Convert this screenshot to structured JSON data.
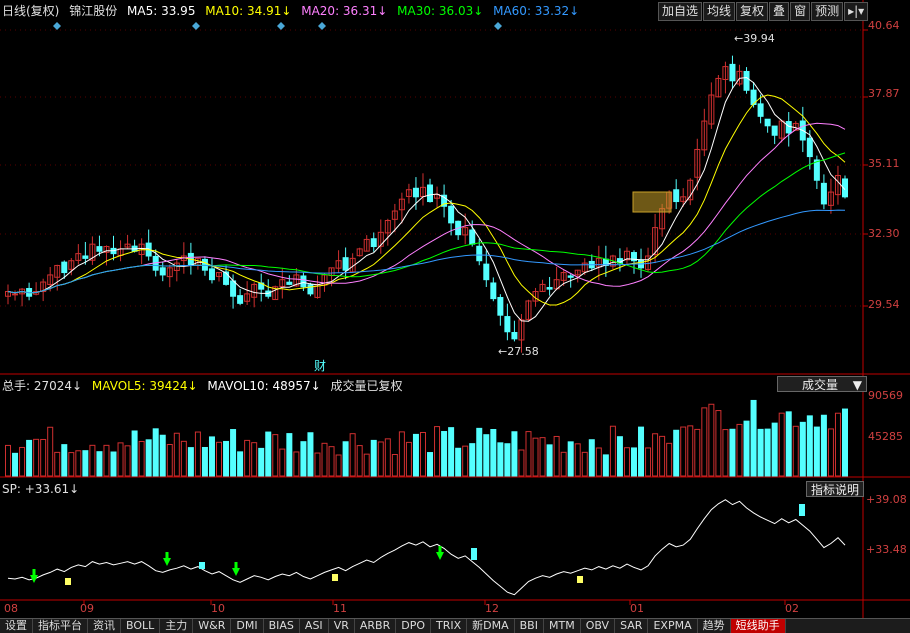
{
  "header": {
    "period": "日线(复权)",
    "stock_name": "锦江股份",
    "ma5_label": "MA5: 33.95",
    "ma10_label": "MA10: 34.91↓",
    "ma20_label": "MA20: 36.31↓",
    "ma30_label": "MA30: 36.03↓",
    "ma60_label": "MA60: 33.32↓"
  },
  "toolbar": {
    "add_watch": "加自选",
    "ma_line": "均线",
    "adjust": "复权",
    "overlay": "叠",
    "window": "窗",
    "forecast": "预测",
    "more": "▸|▾"
  },
  "price_axis": [
    "40.64",
    "37.87",
    "35.11",
    "32.30",
    "29.54"
  ],
  "annotations": {
    "high": "39.94",
    "low": "27.58",
    "finance_marker": "财"
  },
  "volume": {
    "total_label": "总手: 27024↓",
    "mavol5_label": "MAVOL5: 39424↓",
    "mavol10_label": "MAVOL10: 48957↓",
    "note": "成交量已复权",
    "dropdown": "成交量",
    "axis": [
      "90569",
      "45285"
    ]
  },
  "sp": {
    "label": "SP: +33.61↓",
    "button": "指标说明",
    "axis": [
      "+39.08",
      "+33.48"
    ]
  },
  "date_axis": [
    "08",
    "09",
    "10",
    "11",
    "12",
    "01",
    "02"
  ],
  "tabs": [
    "设置",
    "指标平台",
    "资讯",
    "BOLL",
    "主力",
    "W&R",
    "DMI",
    "BIAS",
    "ASI",
    "VR",
    "ARBR",
    "DPO",
    "TRIX",
    "新DMA",
    "BBI",
    "MTM",
    "OBV",
    "SAR",
    "EXPMA",
    "趋势",
    "短线助手"
  ],
  "active_tab": "短线助手",
  "colors": {
    "up": "#d03030",
    "down": "#54ffff",
    "ma5": "#ffffff",
    "ma10": "#ffff00",
    "ma20": "#ff80ff",
    "ma30": "#00ff00",
    "ma60": "#3399ff",
    "axis": "#c00000"
  },
  "chart_data": {
    "type": "candlestick",
    "closes": [
      29.9,
      29.8,
      30.0,
      29.7,
      29.9,
      30.3,
      30.6,
      31.0,
      30.7,
      31.2,
      31.5,
      31.3,
      31.9,
      31.6,
      31.8,
      31.5,
      31.7,
      31.9,
      31.6,
      31.9,
      31.4,
      30.8,
      30.6,
      30.9,
      31.1,
      31.4,
      31.0,
      31.3,
      30.8,
      30.4,
      30.7,
      30.2,
      29.7,
      29.4,
      29.8,
      30.2,
      30.0,
      29.7,
      30.1,
      30.4,
      30.2,
      30.6,
      30.1,
      29.8,
      30.2,
      30.6,
      30.9,
      31.2,
      30.8,
      31.3,
      31.7,
      32.1,
      31.8,
      32.4,
      32.9,
      33.3,
      33.8,
      34.2,
      33.9,
      34.3,
      33.7,
      34.0,
      33.5,
      32.8,
      32.3,
      32.6,
      31.9,
      31.2,
      30.4,
      29.6,
      28.9,
      28.2,
      27.9,
      28.7,
      29.5,
      29.9,
      30.2,
      30.0,
      30.4,
      30.7,
      30.5,
      30.8,
      31.1,
      30.9,
      31.3,
      31.0,
      31.4,
      31.1,
      31.6,
      31.2,
      30.9,
      31.4,
      32.6,
      33.4,
      34.1,
      33.7,
      33.9,
      34.6,
      35.9,
      37.1,
      38.2,
      38.9,
      39.4,
      38.8,
      39.2,
      38.4,
      37.8,
      37.3,
      36.9,
      36.5,
      37.1,
      36.6,
      37.0,
      36.3,
      35.6,
      34.6,
      33.6,
      34.1,
      34.8,
      33.9
    ]
  }
}
